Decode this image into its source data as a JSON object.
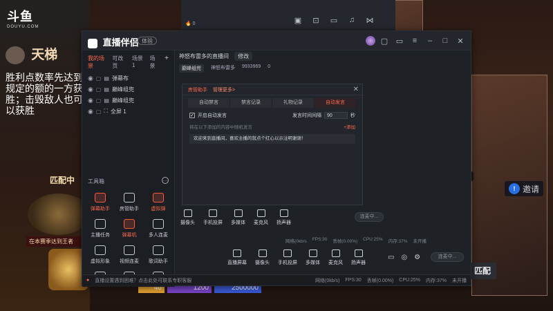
{
  "background": {
    "logo": "斗鱼",
    "logo_sub": "DOUYU.COM",
    "ladder_title": "天梯",
    "rule_text": "胜利点数率先达到规定的额的一方获胜；击毁敌人也可以获胜",
    "match_title": "匹配中",
    "season_text": "在本赛季达到王者",
    "bar_values": [
      "40",
      "1200",
      "2500000"
    ]
  },
  "back_window": {
    "count": "0",
    "icons": [
      "camera-icon",
      "lock-icon",
      "window-icon",
      "bell-icon",
      "share-icon"
    ]
  },
  "app": {
    "name": "直播伴侣",
    "badge": "体验",
    "window_controls": [
      "phone-icon",
      "screen-icon",
      "settings-icon",
      "minimize-icon",
      "maximize-icon",
      "close-icon"
    ]
  },
  "sidebar": {
    "tabs": [
      "我的场景",
      "可改页",
      "场景1",
      "场景"
    ],
    "add_label": "+",
    "sources": [
      "弹幕布",
      "巅峰组兜",
      "巅峰组兜",
      "全屏 1"
    ],
    "tools_title": "工具箱",
    "tools": [
      {
        "label": "弹幕助手",
        "hot": true
      },
      {
        "label": "房管助手",
        "hot": false
      },
      {
        "label": "虚拟弹",
        "hot": true
      },
      {
        "label": "主播任务",
        "hot": false
      },
      {
        "label": "弹幕机",
        "hot": true
      },
      {
        "label": "多人连麦",
        "hot": false
      },
      {
        "label": "虚拟形象",
        "hot": false
      },
      {
        "label": "视频连麦",
        "hot": false
      },
      {
        "label": "歌词助手",
        "hot": false
      },
      {
        "label": "",
        "hot": false
      },
      {
        "label": "",
        "hot": false
      },
      {
        "label": "",
        "hot": false
      }
    ]
  },
  "room": {
    "title": "神怒布雷多的直播间",
    "edit_label": "修改",
    "category": "巅峰组兜",
    "meta_name": "神怒布雷多",
    "meta_id": "9933969",
    "meta_count": "0"
  },
  "dialog": {
    "head_tabs": [
      "房管助手",
      "管理更多>"
    ],
    "sub_tabs": [
      "自动禁言",
      "禁言记录",
      "礼物记录",
      "自动发言"
    ],
    "enable_label": "开启自动发言",
    "interval_label": "发言时间间隔",
    "interval_value": "90",
    "interval_unit": "秒",
    "hint": "将在以下添加的内容中随机发言",
    "add_label": "+添加",
    "message": "欢迎来到直播间，喜欢主播的就点个红心以示注明谢谢！"
  },
  "inner_controls": {
    "buttons": [
      "摄像头",
      "手机投屏",
      "多媒体",
      "麦克风",
      "扬声器"
    ],
    "live_label": "连麦中..."
  },
  "inner_status": {
    "items": [
      "网络(0kb/s",
      "FPS:30",
      "丢帧(0.00%)",
      "CPU:25%",
      "内存:37%",
      "未开播"
    ]
  },
  "controls": {
    "buttons": [
      "直播屏幕",
      "摄像头",
      "手机投屏",
      "多媒体",
      "麦克风",
      "扬声器"
    ],
    "live_label": "连麦中..."
  },
  "status": {
    "warning": "直播设置遇到困难？点击此处可联系专职客服",
    "items": [
      "网络(0kb/s)",
      "FPS:30",
      "丢帧(0.00%)",
      "CPU:25%",
      "内存:37%",
      "未开播"
    ]
  },
  "right_stack": {
    "invite_label": "邀请",
    "cards": [
      "匹配",
      "匹配"
    ]
  }
}
